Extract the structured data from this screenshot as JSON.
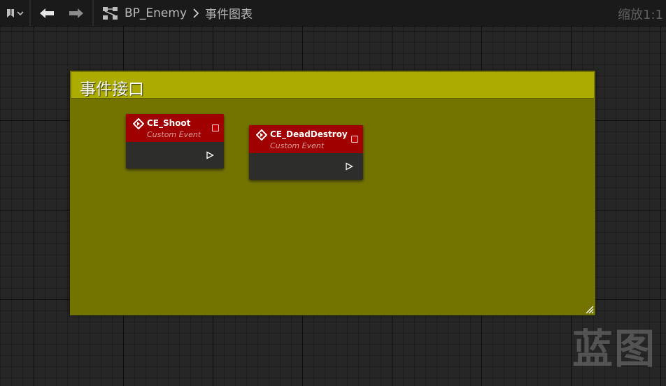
{
  "topbar": {
    "blueprint_name": "BP_Enemy",
    "graph_name": "事件图表",
    "zoom": "缩放1:1"
  },
  "comment": {
    "title": "事件接口"
  },
  "nodes": [
    {
      "title": "CE_Shoot",
      "subtitle": "Custom Event"
    },
    {
      "title": "CE_DeadDestroy",
      "subtitle": "Custom Event"
    }
  ],
  "watermark": "蓝图",
  "colors": {
    "canvas": "#262626",
    "comment_header": "#acac00",
    "comment_body": "#737400",
    "event_header": "#a00000"
  }
}
